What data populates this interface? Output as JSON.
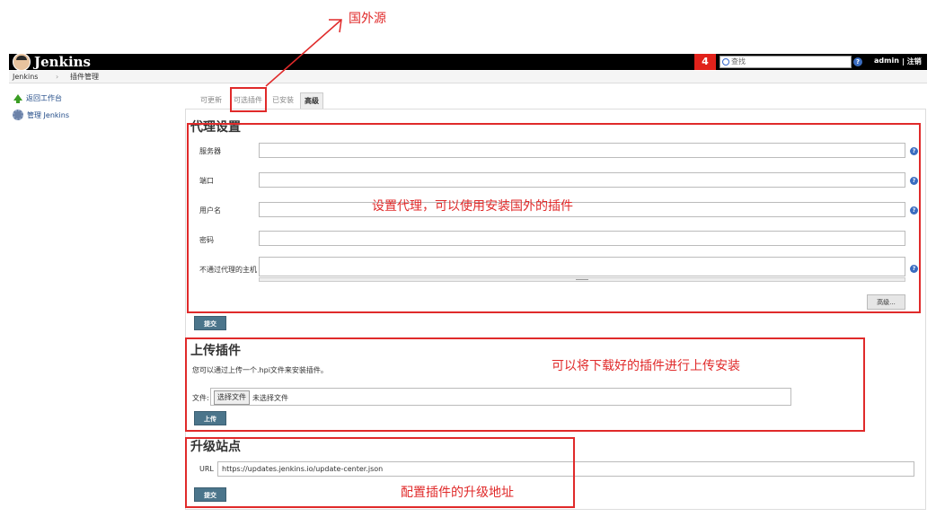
{
  "header": {
    "logo_text": "Jenkins",
    "notification_count": "4",
    "search_placeholder": "查找",
    "help_glyph": "?",
    "user": "admin",
    "logout": "| 注销"
  },
  "breadcrumb": {
    "root": "Jenkins",
    "separator": "›",
    "current": "插件管理"
  },
  "sidebar": {
    "items": [
      {
        "label": "返回工作台",
        "icon": "arrow-up-icon"
      },
      {
        "label": "管理 Jenkins",
        "icon": "gear-icon"
      }
    ]
  },
  "tabs": [
    {
      "label": "可更新",
      "active": false
    },
    {
      "label": "可选插件",
      "active": false
    },
    {
      "label": "已安装",
      "active": false
    },
    {
      "label": "高级",
      "active": true
    }
  ],
  "proxy": {
    "title": "代理设置",
    "fields": [
      {
        "label": "服务器",
        "value": ""
      },
      {
        "label": "端口",
        "value": ""
      },
      {
        "label": "用户名",
        "value": ""
      },
      {
        "label": "密码",
        "value": ""
      },
      {
        "label": "不通过代理的主机",
        "value": ""
      }
    ],
    "advanced_button": "高级...",
    "submit_button": "提交"
  },
  "upload": {
    "title": "上传插件",
    "description": "您可以通过上传一个.hpi文件来安装插件。",
    "file_label": "文件:",
    "choose_button": "选择文件",
    "no_file": "未选择文件",
    "upload_button": "上传"
  },
  "update_site": {
    "title": "升级站点",
    "url_label": "URL",
    "url_value": "https://updates.jenkins.io/update-center.json",
    "submit_button": "提交"
  },
  "annotations": {
    "foreign_source": "国外源",
    "proxy_note": "设置代理，可以使用安装国外的插件",
    "upload_note": "可以将下载好的插件进行上传安装",
    "update_note": "配置插件的升级地址",
    "color": "#e02a2a"
  }
}
